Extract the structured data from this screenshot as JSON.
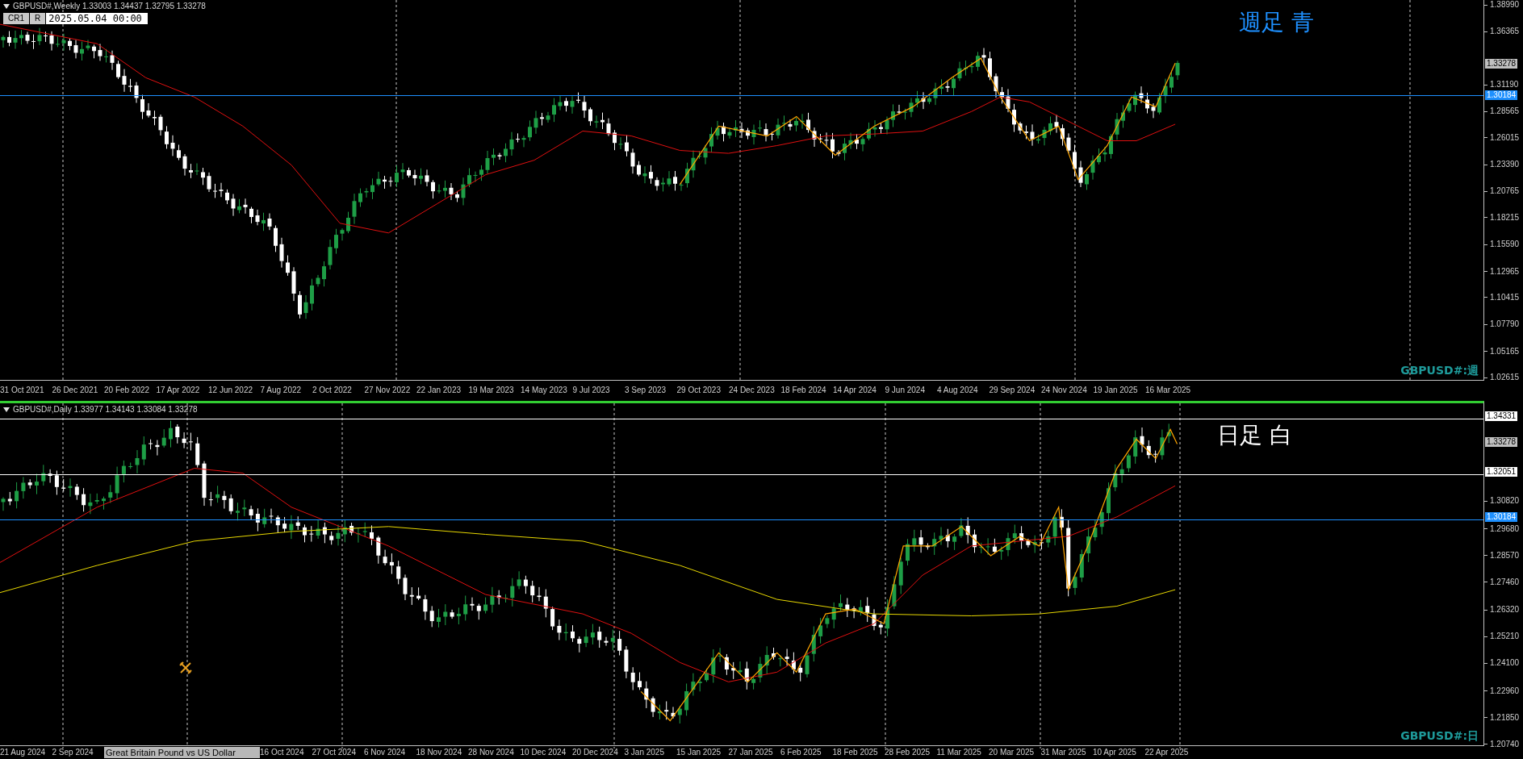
{
  "panes": [
    {
      "kind": "weekly",
      "symbol": "GBPUSD#,Weekly",
      "ohlc": "1.33003 1.34437 1.32795 1.33278",
      "buttons": [
        {
          "label": "CR1"
        },
        {
          "label": "R"
        }
      ],
      "time_field": "2025.05.04 00:00",
      "annotation": {
        "text": "週足 青",
        "color": "#1e90ff"
      },
      "corner_label": "GBPUSD#:週",
      "price_axis": [
        "1.38990",
        "1.36365",
        "1.31190",
        "1.28565",
        "1.26015",
        "1.23390",
        "1.20765",
        "1.18215",
        "1.15590",
        "1.12965",
        "1.10415",
        "1.07790",
        "1.05165",
        "1.02615"
      ],
      "price_tags": [
        {
          "text": "1.33278",
          "kind": "bid"
        },
        {
          "text": "1.30184",
          "kind": "level"
        }
      ],
      "time_axis": [
        "31 Oct 2021",
        "26 Dec 2021",
        "20 Feb 2022",
        "17 Apr 2022",
        "12 Jun 2022",
        "7 Aug 2022",
        "2 Oct 2022",
        "27 Nov 2022",
        "22 Jan 2023",
        "19 Mar 2023",
        "14 May 2023",
        "9 Jul 2023",
        "3 Sep 2023",
        "29 Oct 2023",
        "24 Dec 2023",
        "18 Feb 2024",
        "14 Apr 2024",
        "9 Jun 2024",
        "4 Aug 2024",
        "29 Sep 2024",
        "24 Nov 2024",
        "19 Jan 2025",
        "16 Mar 2025"
      ]
    },
    {
      "kind": "daily",
      "symbol": "GBPUSD#,Daily",
      "ohlc": "1.33977 1.34143 1.33084 1.33278",
      "annotation": {
        "text": "日足 白",
        "color": "#ffffff"
      },
      "corner_label": "GBPUSD#:日",
      "price_axis": [
        "1.30820",
        "1.29680",
        "1.28570",
        "1.27460",
        "1.26320",
        "1.25210",
        "1.24100",
        "1.22960",
        "1.21850",
        "1.20740"
      ],
      "price_tags": [
        {
          "text": "1.34331",
          "kind": "hline"
        },
        {
          "text": "1.33278",
          "kind": "bid"
        },
        {
          "text": "1.32051",
          "kind": "hline"
        },
        {
          "text": "1.30184",
          "kind": "level"
        }
      ],
      "tooltip": "Great Britain Pound vs US Dollar",
      "time_axis": [
        "21 Aug 2024",
        "2 Sep 2024",
        "16 Oct 2024",
        "27 Oct 2024",
        "6 Nov 2024",
        "18 Nov 2024",
        "28 Nov 2024",
        "10 Dec 2024",
        "20 Dec 2024",
        "3 Jan 2025",
        "15 Jan 2025",
        "27 Jan 2025",
        "6 Feb 2025",
        "18 Feb 2025",
        "28 Feb 2025",
        "11 Mar 2025",
        "20 Mar 2025",
        "31 Mar 2025",
        "10 Apr 2025",
        "22 Apr 2025"
      ]
    }
  ]
}
